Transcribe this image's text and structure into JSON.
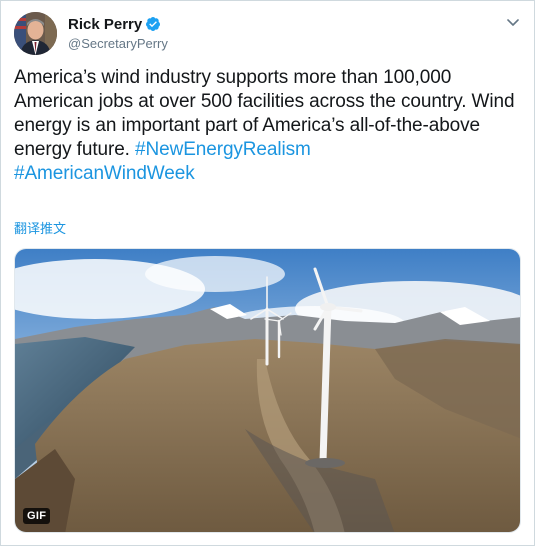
{
  "author": {
    "name": "Rick Perry",
    "handle": "@SecretaryPerry",
    "verified": true
  },
  "tweet": {
    "text_part1": "America’s wind industry supports more than 100,000 American jobs at over 500 facilities across the country. Wind energy is an important part of America’s all-of-the-above energy future. ",
    "hashtag1": "#NewEnergyRealism",
    "hashtag2": "#AmericanWindWeek"
  },
  "translate_label": "翻译推文",
  "media": {
    "badge": "GIF"
  },
  "icons": {
    "verified": "verified-badge-icon",
    "menu": "chevron-down-icon"
  },
  "colors": {
    "accent": "#1b95e0",
    "text": "#14171a",
    "secondary": "#657786"
  }
}
